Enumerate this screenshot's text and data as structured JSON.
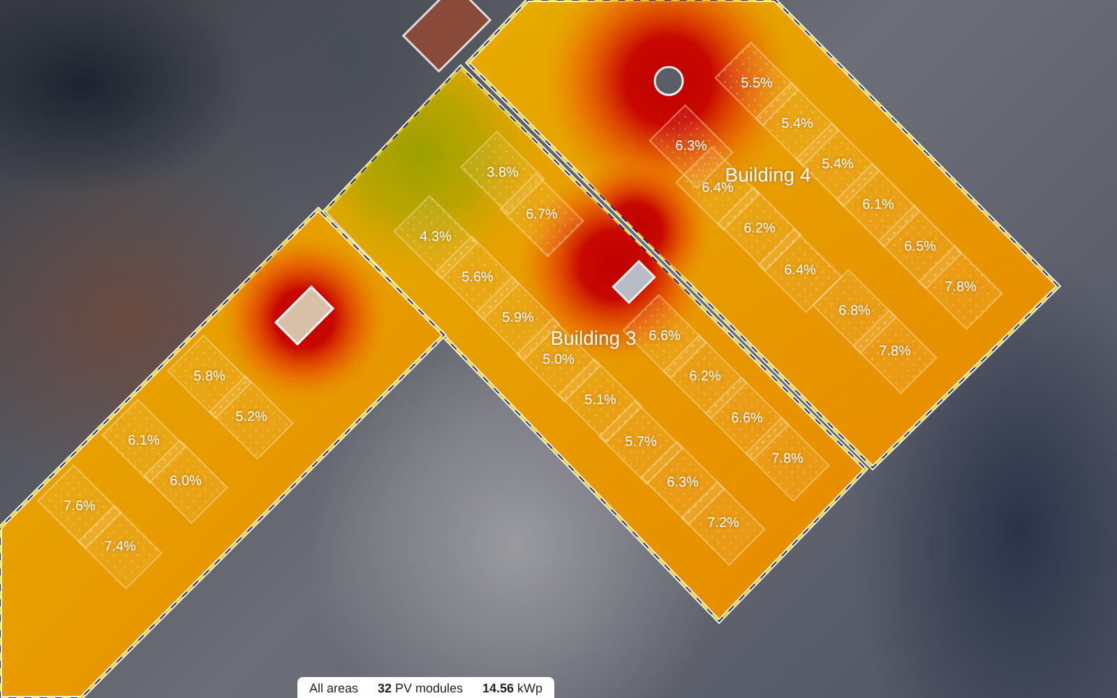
{
  "roofs": [
    {
      "label": "Building 4",
      "modules": [
        {
          "yield": "5.5%"
        },
        {
          "yield": "5.4%"
        },
        {
          "yield": "6.3%"
        },
        {
          "yield": "5.4%"
        },
        {
          "yield": "6.4%"
        },
        {
          "yield": "6.1%"
        },
        {
          "yield": "6.2%"
        },
        {
          "yield": "6.5%"
        },
        {
          "yield": "6.4%"
        },
        {
          "yield": "7.8%"
        },
        {
          "yield": "6.8%"
        },
        {
          "yield": "7.8%"
        }
      ]
    },
    {
      "label": "Building 3",
      "modules": [
        {
          "yield": "3.8%"
        },
        {
          "yield": "6.7%"
        },
        {
          "yield": "4.3%"
        },
        {
          "yield": "5.6%"
        },
        {
          "yield": "5.9%"
        },
        {
          "yield": "6.6%"
        },
        {
          "yield": "5.0%"
        },
        {
          "yield": "6.2%"
        },
        {
          "yield": "5.1%"
        },
        {
          "yield": "6.6%"
        },
        {
          "yield": "5.7%"
        },
        {
          "yield": "7.8%"
        },
        {
          "yield": "6.3%"
        },
        {
          "yield": "7.2%"
        }
      ]
    },
    {
      "modules": [
        {
          "yield": "5.8%"
        },
        {
          "yield": "5.2%"
        },
        {
          "yield": "6.1%"
        },
        {
          "yield": "6.0%"
        },
        {
          "yield": "7.6%"
        },
        {
          "yield": "7.4%"
        }
      ]
    }
  ],
  "status_bar": {
    "area": "All areas",
    "modules": "**32** PV modules",
    "power": "**14.56** kWp"
  }
}
